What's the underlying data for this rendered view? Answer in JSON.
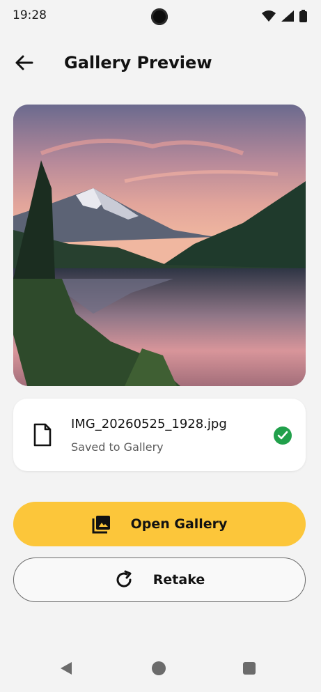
{
  "status": {
    "time": "19:28"
  },
  "app_bar": {
    "title": "Gallery Preview"
  },
  "file": {
    "name": "IMG_20260525_1928.jpg",
    "status": "Saved to Gallery"
  },
  "actions": {
    "open_gallery": "Open Gallery",
    "retake": "Retake"
  },
  "colors": {
    "accent": "#fcc63a",
    "success": "#21a04b",
    "background": "#f3f3f3"
  },
  "icons": {
    "back": "arrow-left-icon",
    "file": "file-icon",
    "saved": "check-circle-icon",
    "gallery": "gallery-icon",
    "retake": "refresh-icon"
  }
}
